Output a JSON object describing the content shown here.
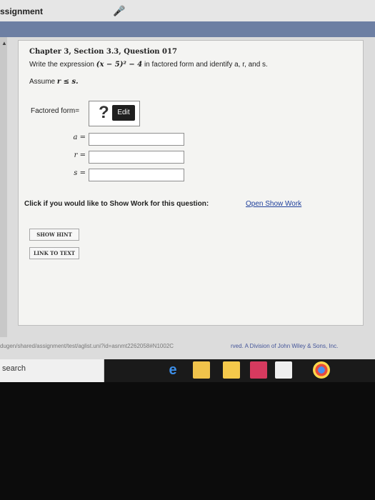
{
  "app": {
    "title": "ssignment"
  },
  "question": {
    "title": "Chapter 3, Section 3.3, Question 017",
    "prompt_prefix": "Write the expression",
    "expression": "(x − 5)² − 4",
    "prompt_suffix": "in factored form and identify a, r, and s.",
    "assume_label": "Assume",
    "assume_math": "r ≤ s."
  },
  "answer": {
    "factored_label": "Factored form=",
    "placeholder_symbol": "?",
    "edit_label": "Edit"
  },
  "variables": [
    {
      "label": "a =",
      "value": ""
    },
    {
      "label": "r =",
      "value": ""
    },
    {
      "label": "s =",
      "value": ""
    }
  ],
  "show_work": {
    "question": "Click if you would like to Show Work for this question:",
    "link": "Open Show Work"
  },
  "buttons": {
    "hint": "SHOW HINT",
    "link_text": "LINK TO TEXT"
  },
  "status": {
    "url": "dugen/shared/assignment/test/aglist.uni?id=asnmt2262058#N1002C",
    "copyright": "rved. A Division of John Wiley & Sons, Inc."
  },
  "taskbar": {
    "search_placeholder": "search"
  }
}
